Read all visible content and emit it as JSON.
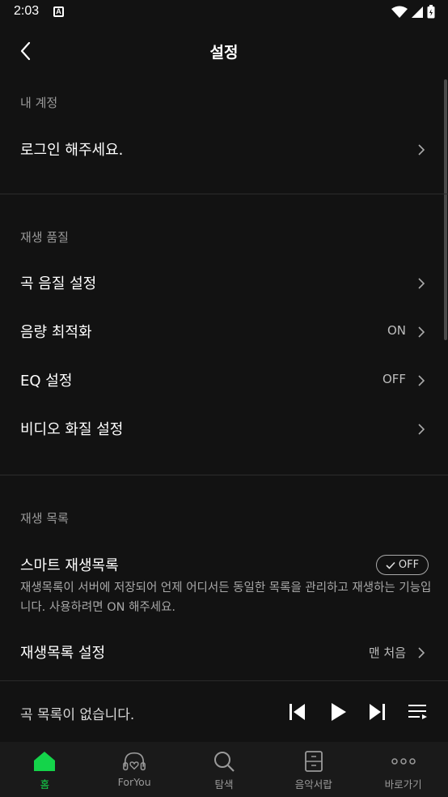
{
  "status_bar": {
    "time": "2:03",
    "notification_letter": "A"
  },
  "header": {
    "title": "설정"
  },
  "sections": {
    "account": {
      "title": "내 계정",
      "login_label": "로그인 해주세요."
    },
    "quality": {
      "title": "재생 품질",
      "items": [
        {
          "label": "곡 음질 설정",
          "value": ""
        },
        {
          "label": "음량 최적화",
          "value": "ON"
        },
        {
          "label": "EQ 설정",
          "value": "OFF"
        },
        {
          "label": "비디오 화질 설정",
          "value": ""
        }
      ]
    },
    "playlist": {
      "title": "재생 목록",
      "smart_label": "스마트 재생목록",
      "smart_toggle": "OFF",
      "smart_desc": "재생목록이 서버에 저장되어 언제 어디서든 동일한 목록을 관리하고 재생하는 기능입니다. 사용하려면 ON 해주세요.",
      "settings_label": "재생목록 설정",
      "settings_value": "맨 처음"
    }
  },
  "mini_player": {
    "empty_text": "곡 목록이 없습니다."
  },
  "bottom_nav": [
    {
      "label": "홈",
      "icon": "home-icon",
      "active": true
    },
    {
      "label": "ForYou",
      "icon": "headphones-heart-icon",
      "active": false
    },
    {
      "label": "탐색",
      "icon": "search-icon",
      "active": false
    },
    {
      "label": "음악서랍",
      "icon": "drawer-icon",
      "active": false
    },
    {
      "label": "바로가기",
      "icon": "more-dots-icon",
      "active": false
    }
  ],
  "colors": {
    "background": "#121212",
    "accent": "#14d44a",
    "secondary_text": "#9a9a9a"
  }
}
